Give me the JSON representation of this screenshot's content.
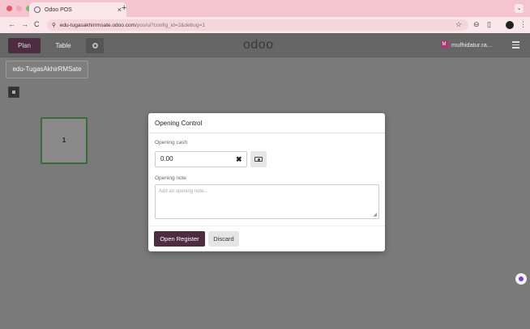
{
  "browser": {
    "tab_title": "Odoo POS",
    "tab_close": "×",
    "new_tab": "+",
    "url_host": "edu-tugasakhirrmsate.odoo.com",
    "url_path": "/pos/ui?config_id=2&debug=1",
    "back": "←",
    "forward": "→",
    "reload": "C",
    "window_menu": "⌄",
    "dot_colors": [
      "#e8566b",
      "#f0a8b5",
      "#6ac26a"
    ]
  },
  "header": {
    "plan_label": "Plan",
    "table_label": "Table",
    "logo_text": "odoo",
    "user_name": "mufhidatur.ra...",
    "user_initial": "M"
  },
  "floor": {
    "floor_name": "edu-TugasAkhirRMSate",
    "table_number": "1"
  },
  "dialog": {
    "title": "Opening Control",
    "cash_label": "Opening cash",
    "cash_value": "0.00",
    "clear_glyph": "✖",
    "note_label": "Opening note",
    "note_placeholder": "Add an opening note...",
    "open_register_label": "Open Register",
    "discard_label": "Discard"
  },
  "colors": {
    "primary": "#4d2b40",
    "tab_bar": "#f4c5cf"
  }
}
